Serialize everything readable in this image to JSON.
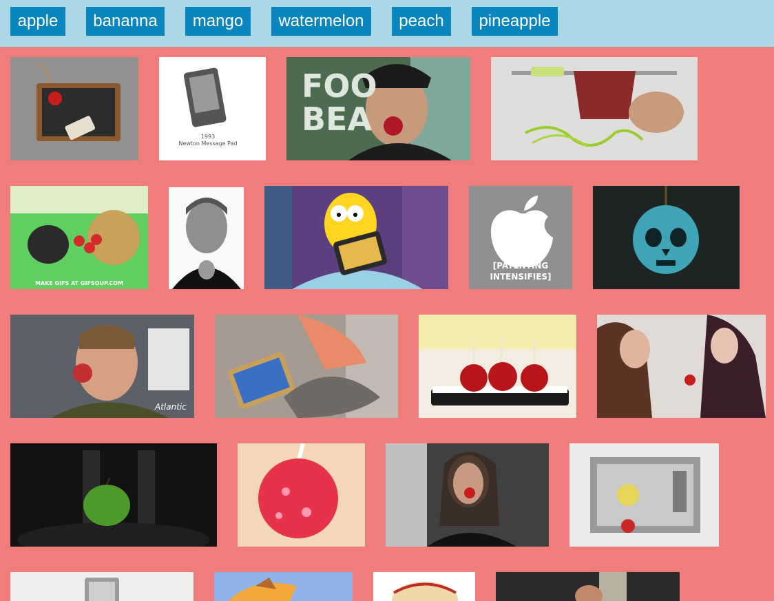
{
  "tags": [
    {
      "label": "apple"
    },
    {
      "label": "bananna"
    },
    {
      "label": "mango"
    },
    {
      "label": "watermelon"
    },
    {
      "label": "peach"
    },
    {
      "label": "pineapple"
    }
  ],
  "gifs": {
    "newton_caption_year": "1993",
    "newton_caption_name": "Newton Message Pad",
    "foodbeast_text_1": "FOO",
    "foodbeast_text_2": "BEA",
    "gifsoup_credit": "MAKE GIFS AT GIFSOUP.COM",
    "patenting_line_1": "[PATENTING",
    "patenting_line_2": "INTENSIFIES]",
    "atlantic_watermark": "Atlantic"
  },
  "colors": {
    "page_background": "#f07c7c",
    "topbar_background": "#acd8e6",
    "tag_background": "#0a86be",
    "tag_text": "#ffffff"
  }
}
